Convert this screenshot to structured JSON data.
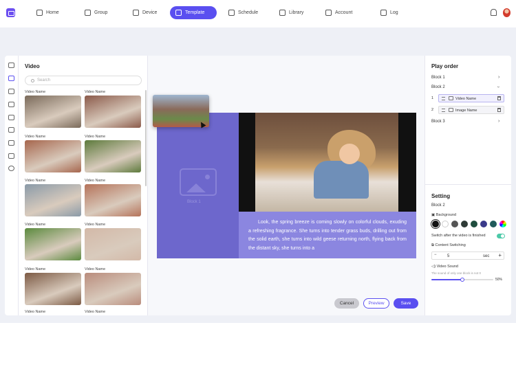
{
  "nav": {
    "items": [
      {
        "label": "Home",
        "icon": "home-icon"
      },
      {
        "label": "Group",
        "icon": "group-icon"
      },
      {
        "label": "Device",
        "icon": "device-icon"
      },
      {
        "label": "Template",
        "icon": "template-icon",
        "active": true
      },
      {
        "label": "Schedule",
        "icon": "clock-icon"
      },
      {
        "label": "Library",
        "icon": "library-icon"
      },
      {
        "label": "Account",
        "icon": "account-icon"
      },
      {
        "label": "Log",
        "icon": "log-icon"
      }
    ]
  },
  "media": {
    "title": "Video",
    "search_placeholder": "Search",
    "items": [
      {
        "name": "Video Name",
        "color": "#7a6a5a"
      },
      {
        "name": "Video Name",
        "color": "#8b5a4a"
      },
      {
        "name": "Video Name",
        "color": "#a6664d"
      },
      {
        "name": "Video Name",
        "color": "#5d7a3c"
      },
      {
        "name": "Video Name",
        "color": "#8a9aa8"
      },
      {
        "name": "Video Name",
        "color": "#b5735a"
      },
      {
        "name": "Video Name",
        "color": "#5b8a3e"
      },
      {
        "name": "Video Name",
        "color": "#d3b9a8"
      },
      {
        "name": "Video Name",
        "color": "#7c5a44"
      },
      {
        "name": "Video Name",
        "color": "#b98c7c"
      },
      {
        "name": "Video Name",
        "color": "#8a6a5a"
      },
      {
        "name": "Video Name",
        "color": "#6a6a6a"
      }
    ]
  },
  "canvas": {
    "block1_label": "Block 1",
    "caption": "Look, the spring breeze is coming slowly on colorful clouds, exuding a refreshing fragrance. She turns into tender grass buds, drilling out from the solid earth, she turns into wild geese returning north, flying back from the distant sky, she turns into a"
  },
  "actions": {
    "cancel": "Cancel",
    "preview": "Preview",
    "save": "Save"
  },
  "play_order": {
    "title": "Play order",
    "block1": "Block 1",
    "block2": "Block 2",
    "block3": "Block 3",
    "rows": [
      {
        "num": "1",
        "label": "Video Name"
      },
      {
        "num": "2",
        "label": "Image Name"
      }
    ]
  },
  "setting": {
    "title": "Setting",
    "block": "Block 2",
    "background_label": "Background",
    "colors": [
      "#111111",
      "#ffffff",
      "#555555",
      "#2f3b37",
      "#1f4d3e",
      "#3a3a8a",
      "#1f5a5a",
      "conic"
    ],
    "switch_after_label": "Switch after the video is finished",
    "switch_after_on": true,
    "content_switching_label": "Content Switching",
    "content_switching_value": "5",
    "content_switching_unit": "sec",
    "video_sound_label": "Video Sound",
    "video_sound_hint": "The sound of only one block is not 0",
    "video_sound_value": "50%",
    "video_sound_fraction": 0.5
  }
}
